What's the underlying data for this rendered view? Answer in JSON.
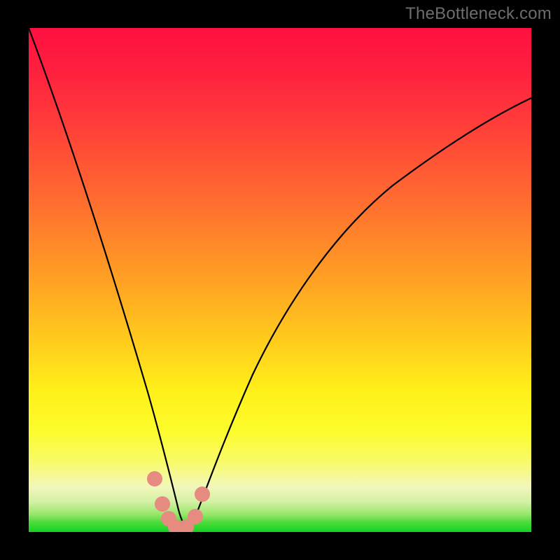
{
  "watermark": "TheBottleneck.com",
  "chart_data": {
    "type": "line",
    "title": "",
    "xlabel": "",
    "ylabel": "",
    "xlim": [
      0,
      100
    ],
    "ylim": [
      0,
      100
    ],
    "background_gradient_stops": [
      {
        "pos": 0,
        "color": "#ff1041"
      },
      {
        "pos": 18,
        "color": "#ff3a3a"
      },
      {
        "pos": 35,
        "color": "#ff6f2f"
      },
      {
        "pos": 50,
        "color": "#ffa123"
      },
      {
        "pos": 63,
        "color": "#ffcf1c"
      },
      {
        "pos": 80,
        "color": "#fcfc2c"
      },
      {
        "pos": 91,
        "color": "#f2f7bb"
      },
      {
        "pos": 96,
        "color": "#96e76a"
      },
      {
        "pos": 100,
        "color": "#13d321"
      }
    ],
    "series": [
      {
        "name": "bottleneck-curve",
        "color": "#000000",
        "x": [
          0,
          2,
          5,
          8,
          11,
          14,
          17,
          20,
          22,
          24,
          25.5,
          27,
          28,
          29,
          30,
          31,
          32,
          33,
          34,
          36,
          40,
          45,
          50,
          55,
          60,
          65,
          70,
          75,
          80,
          85,
          90,
          95,
          100
        ],
        "y": [
          100,
          91,
          80,
          70,
          60,
          50,
          41,
          31,
          23,
          15,
          9,
          5,
          2.5,
          1.2,
          0.6,
          0.5,
          0.7,
          1.5,
          3,
          8,
          18,
          30,
          40,
          48,
          55,
          60,
          64.5,
          68,
          71,
          73.5,
          75.5,
          77.3,
          78.8
        ]
      }
    ],
    "markers": [
      {
        "name": "dot-left-upper",
        "x": 25.0,
        "y": 10.5,
        "color": "#e58b80"
      },
      {
        "name": "dot-left-mid",
        "x": 26.6,
        "y": 5.5,
        "color": "#e58b80"
      },
      {
        "name": "dot-left-lower",
        "x": 27.8,
        "y": 2.6,
        "color": "#e58b80"
      },
      {
        "name": "dot-bottom-left",
        "x": 29.2,
        "y": 1.0,
        "color": "#e58b80"
      },
      {
        "name": "dot-bottom-right",
        "x": 31.3,
        "y": 0.9,
        "color": "#e58b80"
      },
      {
        "name": "dot-right-lower",
        "x": 33.2,
        "y": 3.0,
        "color": "#e58b80"
      },
      {
        "name": "dot-right-upper",
        "x": 34.5,
        "y": 7.5,
        "color": "#e58b80"
      }
    ]
  }
}
